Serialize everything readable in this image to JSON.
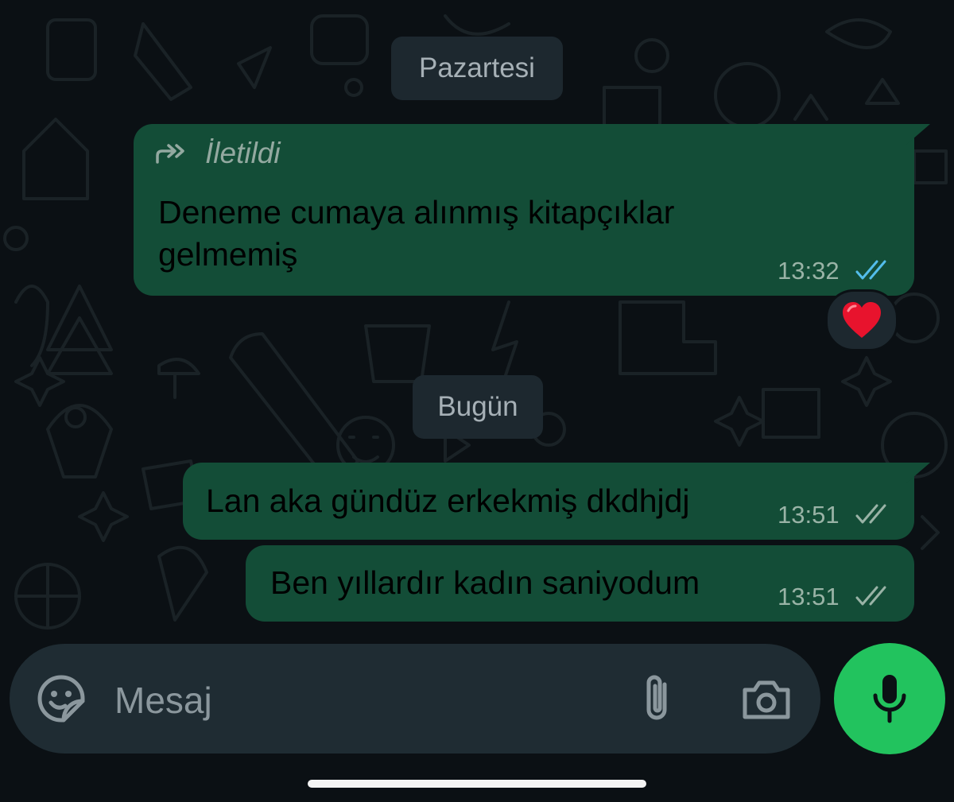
{
  "date_chips": {
    "monday": "Pazartesi",
    "today": "Bugün"
  },
  "messages": [
    {
      "forwarded_label": "İletildi",
      "text_line1": "Deneme cumaya alınmış kitapçıklar",
      "text_line2": "gelmemiş",
      "time": "13:32",
      "status": "read",
      "reaction": "❤️"
    },
    {
      "text": "Lan aka gündüz erkekmiş dkdhjdj",
      "time": "13:51",
      "status": "delivered"
    },
    {
      "text": "Ben yıllardır kadın saniyodum",
      "time": "13:51",
      "status": "delivered"
    }
  ],
  "composer": {
    "placeholder": "Mesaj",
    "icons": [
      "sticker-icon",
      "paperclip-icon",
      "camera-icon",
      "microphone-icon"
    ]
  },
  "colors": {
    "background": "#0b1014",
    "outgoing_bubble": "#134d37",
    "date_chip": "#1d282f",
    "read_ticks": "#53bdeb",
    "delivered_ticks": "#99b3a6",
    "mic_button": "#22c35e"
  }
}
